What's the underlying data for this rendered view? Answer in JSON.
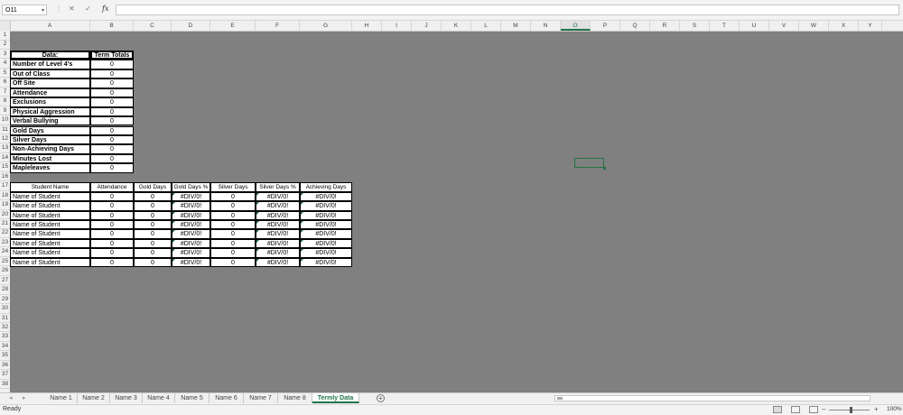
{
  "formula_bar": {
    "name_box": "O11",
    "cancel_icon": "✕",
    "enter_icon": "✓",
    "fx_label": "fx",
    "formula": ""
  },
  "columns": [
    "A",
    "B",
    "C",
    "D",
    "E",
    "F",
    "G",
    "H",
    "I",
    "J",
    "K",
    "L",
    "M",
    "N",
    "O",
    "P",
    "Q",
    "R",
    "S",
    "T",
    "U",
    "V",
    "W",
    "X",
    "Y"
  ],
  "selected_column": "O",
  "rows": [
    "1",
    "2",
    "3",
    "4",
    "5",
    "6",
    "7",
    "8",
    "9",
    "10",
    "11",
    "12",
    "13",
    "14",
    "15",
    "16",
    "17",
    "18",
    "19",
    "20",
    "21",
    "22",
    "23",
    "24",
    "25",
    "26",
    "27",
    "28",
    "29",
    "30",
    "31",
    "32",
    "33",
    "34",
    "35",
    "36",
    "37",
    "38"
  ],
  "summary": {
    "header_label": "Data:",
    "header_value": "Term Totals",
    "items": [
      {
        "label": "Number of Level 4's",
        "value": "0"
      },
      {
        "label": "Out of Class",
        "value": "0"
      },
      {
        "label": "Off Site",
        "value": "0"
      },
      {
        "label": "Attendance",
        "value": "0"
      },
      {
        "label": "Exclusions",
        "value": "0"
      },
      {
        "label": "Physical Aggression",
        "value": "0"
      },
      {
        "label": "Verbal Bullying",
        "value": "0"
      },
      {
        "label": "Gold Days",
        "value": "0"
      },
      {
        "label": "Silver Days",
        "value": "0"
      },
      {
        "label": "Non-Achieving Days",
        "value": "0"
      },
      {
        "label": "Minutes Lost",
        "value": "0"
      },
      {
        "label": "Mapleleaves",
        "value": "0"
      }
    ]
  },
  "student_table": {
    "headers": [
      "Student Name",
      "Attendance",
      "Gold Days",
      "Gold Days %",
      "Silver Days",
      "Silver Days %",
      "Achieving Days"
    ],
    "rows": [
      [
        "Name of Student",
        "0",
        "0",
        "#DIV/0!",
        "0",
        "#DIV/0!",
        "#DIV/0!"
      ],
      [
        "Name of Student",
        "0",
        "0",
        "#DIV/0!",
        "0",
        "#DIV/0!",
        "#DIV/0!"
      ],
      [
        "Name of Student",
        "0",
        "0",
        "#DIV/0!",
        "0",
        "#DIV/0!",
        "#DIV/0!"
      ],
      [
        "Name of Student",
        "0",
        "0",
        "#DIV/0!",
        "0",
        "#DIV/0!",
        "#DIV/0!"
      ],
      [
        "Name of Student",
        "0",
        "0",
        "#DIV/0!",
        "0",
        "#DIV/0!",
        "#DIV/0!"
      ],
      [
        "Name of Student",
        "0",
        "0",
        "#DIV/0!",
        "0",
        "#DIV/0!",
        "#DIV/0!"
      ],
      [
        "Name of Student",
        "0",
        "0",
        "#DIV/0!",
        "0",
        "#DIV/0!",
        "#DIV/0!"
      ],
      [
        "Name of Student",
        "0",
        "0",
        "#DIV/0!",
        "0",
        "#DIV/0!",
        "#DIV/0!"
      ]
    ]
  },
  "sheet_tabs": [
    "Name 1",
    "Name 2",
    "Name 3",
    "Name 4",
    "Name 5",
    "Name 6",
    "Name 7",
    "Name 8",
    "Termly Data"
  ],
  "active_tab": "Termly Data",
  "status": {
    "text": "Ready",
    "zoom": "100%"
  },
  "colors": {
    "grid_bg": "#808080",
    "accent": "#217346"
  }
}
